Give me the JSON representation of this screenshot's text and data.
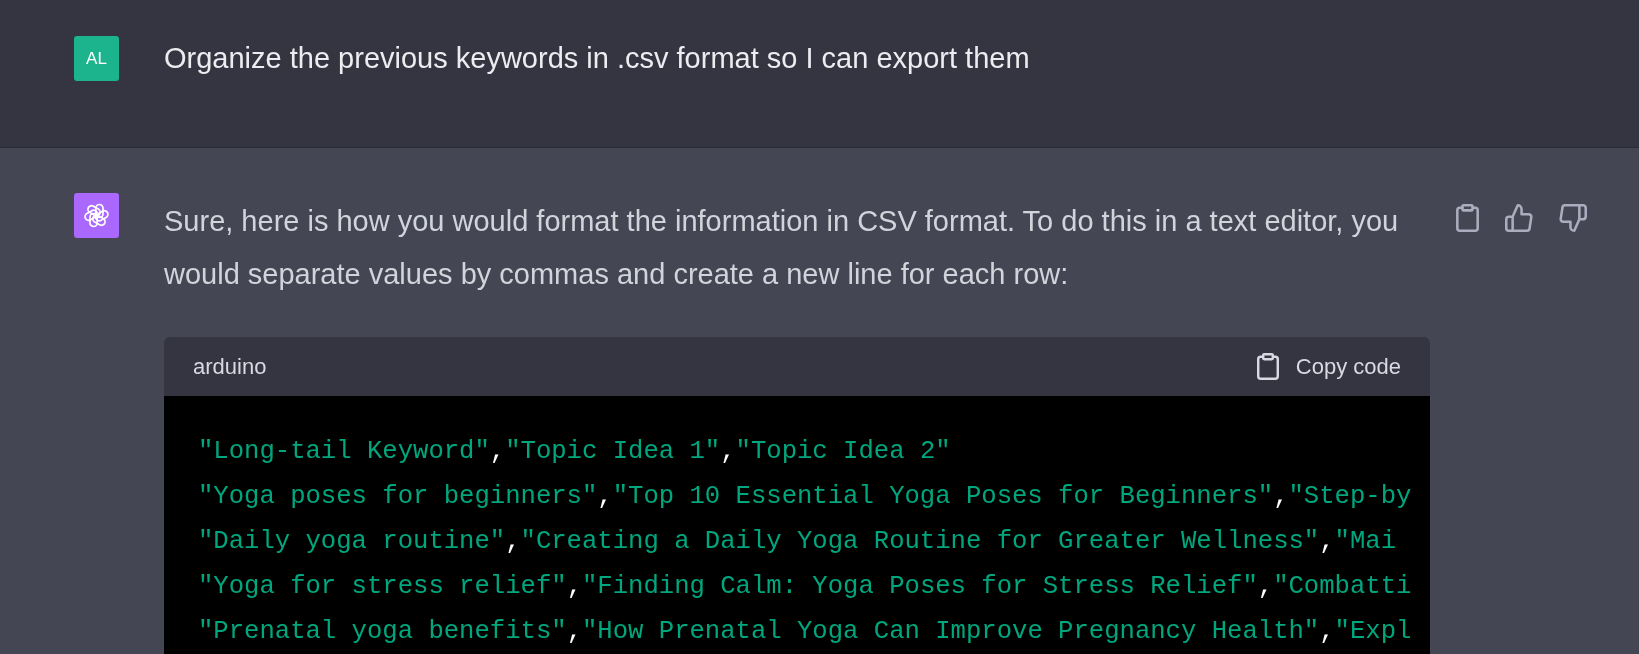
{
  "user_message": {
    "avatar_initials": "AL",
    "text": "Organize the previous keywords in .csv format so I can export them"
  },
  "assistant_message": {
    "text": "Sure, here is how you would format the information in CSV format. To do this in a text editor, you would separate values by commas and create a new line for each row:",
    "code_block": {
      "language": "arduino",
      "copy_label": "Copy code",
      "lines": [
        [
          {
            "kind": "string",
            "text": "\"Long-tail Keyword\""
          },
          {
            "kind": "punct",
            "text": ","
          },
          {
            "kind": "string",
            "text": "\"Topic Idea 1\""
          },
          {
            "kind": "punct",
            "text": ","
          },
          {
            "kind": "string",
            "text": "\"Topic Idea 2\""
          }
        ],
        [
          {
            "kind": "string",
            "text": "\"Yoga poses for beginners\""
          },
          {
            "kind": "punct",
            "text": ","
          },
          {
            "kind": "string",
            "text": "\"Top 10 Essential Yoga Poses for Beginners\""
          },
          {
            "kind": "punct",
            "text": ","
          },
          {
            "kind": "string",
            "text": "\"Step-by"
          }
        ],
        [
          {
            "kind": "string",
            "text": "\"Daily yoga routine\""
          },
          {
            "kind": "punct",
            "text": ","
          },
          {
            "kind": "string",
            "text": "\"Creating a Daily Yoga Routine for Greater Wellness\""
          },
          {
            "kind": "punct",
            "text": ","
          },
          {
            "kind": "string",
            "text": "\"Mai"
          }
        ],
        [
          {
            "kind": "string",
            "text": "\"Yoga for stress relief\""
          },
          {
            "kind": "punct",
            "text": ","
          },
          {
            "kind": "string",
            "text": "\"Finding Calm: Yoga Poses for Stress Relief\""
          },
          {
            "kind": "punct",
            "text": ","
          },
          {
            "kind": "string",
            "text": "\"Combatti"
          }
        ],
        [
          {
            "kind": "string",
            "text": "\"Prenatal yoga benefits\""
          },
          {
            "kind": "punct",
            "text": ","
          },
          {
            "kind": "string",
            "text": "\"How Prenatal Yoga Can Improve Pregnancy Health\""
          },
          {
            "kind": "punct",
            "text": ","
          },
          {
            "kind": "string",
            "text": "\"Expl"
          }
        ]
      ]
    }
  }
}
